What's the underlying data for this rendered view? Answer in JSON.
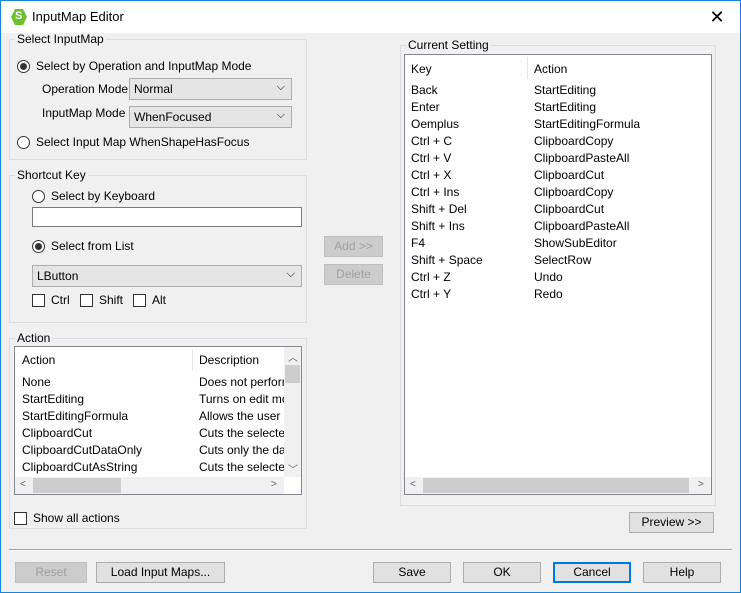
{
  "window": {
    "title": "InputMap Editor",
    "close": "✕"
  },
  "select_inputmap": {
    "legend": "Select InputMap",
    "radio_operation": "Select by Operation and InputMap Mode",
    "operation_mode_label": "Operation Mode",
    "operation_mode_value": "Normal",
    "inputmap_mode_label": "InputMap Mode",
    "inputmap_mode_value": "WhenFocused",
    "radio_shape": "Select Input Map WhenShapeHasFocus"
  },
  "shortcut": {
    "legend": "Shortcut Key",
    "radio_keyboard": "Select by Keyboard",
    "keyboard_value": "",
    "radio_list": "Select from List",
    "list_value": "LButton",
    "ctrl": "Ctrl",
    "shift": "Shift",
    "alt": "Alt"
  },
  "middle": {
    "add": "Add >>",
    "delete": "Delete"
  },
  "action": {
    "legend": "Action",
    "col_action": "Action",
    "col_description": "Description",
    "rows": [
      [
        "None",
        "Does not perform"
      ],
      [
        "StartEditing",
        "Turns on edit mod"
      ],
      [
        "StartEditingFormula",
        "Allows the user to"
      ],
      [
        "ClipboardCut",
        "Cuts the selected"
      ],
      [
        "ClipboardCutDataOnly",
        "Cuts only the data"
      ],
      [
        "ClipboardCutAsString",
        "Cuts the selected"
      ]
    ],
    "show_all": "Show all actions"
  },
  "current": {
    "legend": "Current Setting",
    "col_key": "Key",
    "col_action": "Action",
    "rows": [
      [
        "Back",
        "StartEditing"
      ],
      [
        "Enter",
        "StartEditing"
      ],
      [
        "Oemplus",
        "StartEditingFormula"
      ],
      [
        "Ctrl + C",
        "ClipboardCopy"
      ],
      [
        "Ctrl + V",
        "ClipboardPasteAll"
      ],
      [
        "Ctrl + X",
        "ClipboardCut"
      ],
      [
        "Ctrl + Ins",
        "ClipboardCopy"
      ],
      [
        "Shift + Del",
        "ClipboardCut"
      ],
      [
        "Shift + Ins",
        "ClipboardPasteAll"
      ],
      [
        "F4",
        "ShowSubEditor"
      ],
      [
        "Shift + Space",
        "SelectRow"
      ],
      [
        "Ctrl + Z",
        "Undo"
      ],
      [
        "Ctrl + Y",
        "Redo"
      ]
    ]
  },
  "preview": "Preview >>",
  "footer": {
    "reset": "Reset",
    "load": "Load Input Maps...",
    "save": "Save",
    "ok": "OK",
    "cancel": "Cancel",
    "help": "Help"
  }
}
